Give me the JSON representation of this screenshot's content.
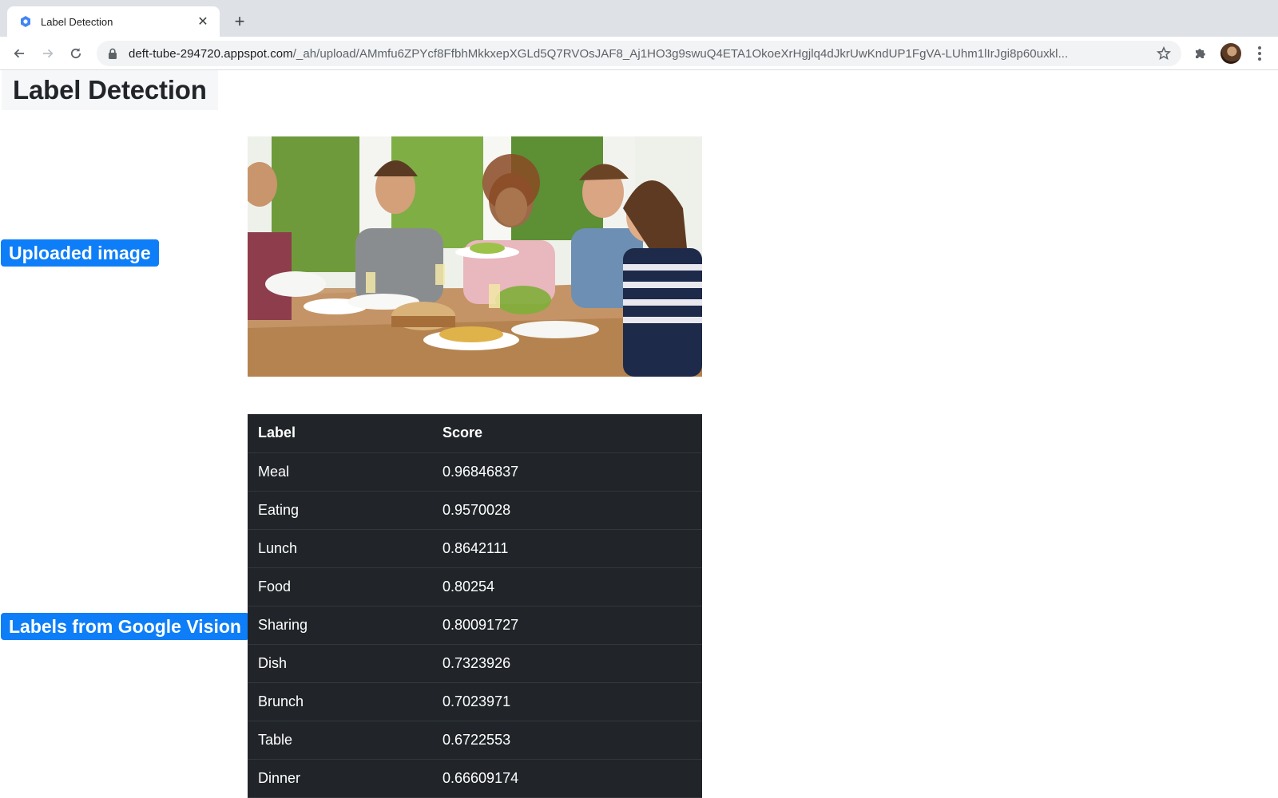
{
  "browser": {
    "tab_title": "Label Detection",
    "url_host": "deft-tube-294720.appspot.com",
    "url_path": "/_ah/upload/AMmfu6ZPYcf8FfbhMkkxepXGLd5Q7RVOsJAF8_Aj1HO3g9swuQ4ETA1OkoeXrHgjlq4dJkrUwKndUP1FgVA-LUhm1lIrJgi8p60uxkl..."
  },
  "page": {
    "title": "Label Detection",
    "uploaded_badge": "Uploaded image",
    "labels_badge": "Labels from Google Vision"
  },
  "table": {
    "headers": [
      "Label",
      "Score"
    ],
    "rows": [
      {
        "label": "Meal",
        "score": "0.96846837"
      },
      {
        "label": "Eating",
        "score": "0.9570028"
      },
      {
        "label": "Lunch",
        "score": "0.8642111"
      },
      {
        "label": "Food",
        "score": "0.80254"
      },
      {
        "label": "Sharing",
        "score": "0.80091727"
      },
      {
        "label": "Dish",
        "score": "0.7323926"
      },
      {
        "label": "Brunch",
        "score": "0.7023971"
      },
      {
        "label": "Table",
        "score": "0.6722553"
      },
      {
        "label": "Dinner",
        "score": "0.66609174"
      }
    ]
  },
  "icons": {
    "favicon": "google-cloud-icon",
    "back": "arrow-left-icon",
    "forward": "arrow-right-icon",
    "reload": "reload-icon",
    "lock": "lock-icon",
    "bookmark": "star-icon",
    "extensions": "puzzle-icon",
    "menu": "kebab-menu-icon"
  },
  "colors": {
    "badge": "#0d7ef8",
    "table_bg": "#212529",
    "tabstrip": "#dee1e6"
  }
}
